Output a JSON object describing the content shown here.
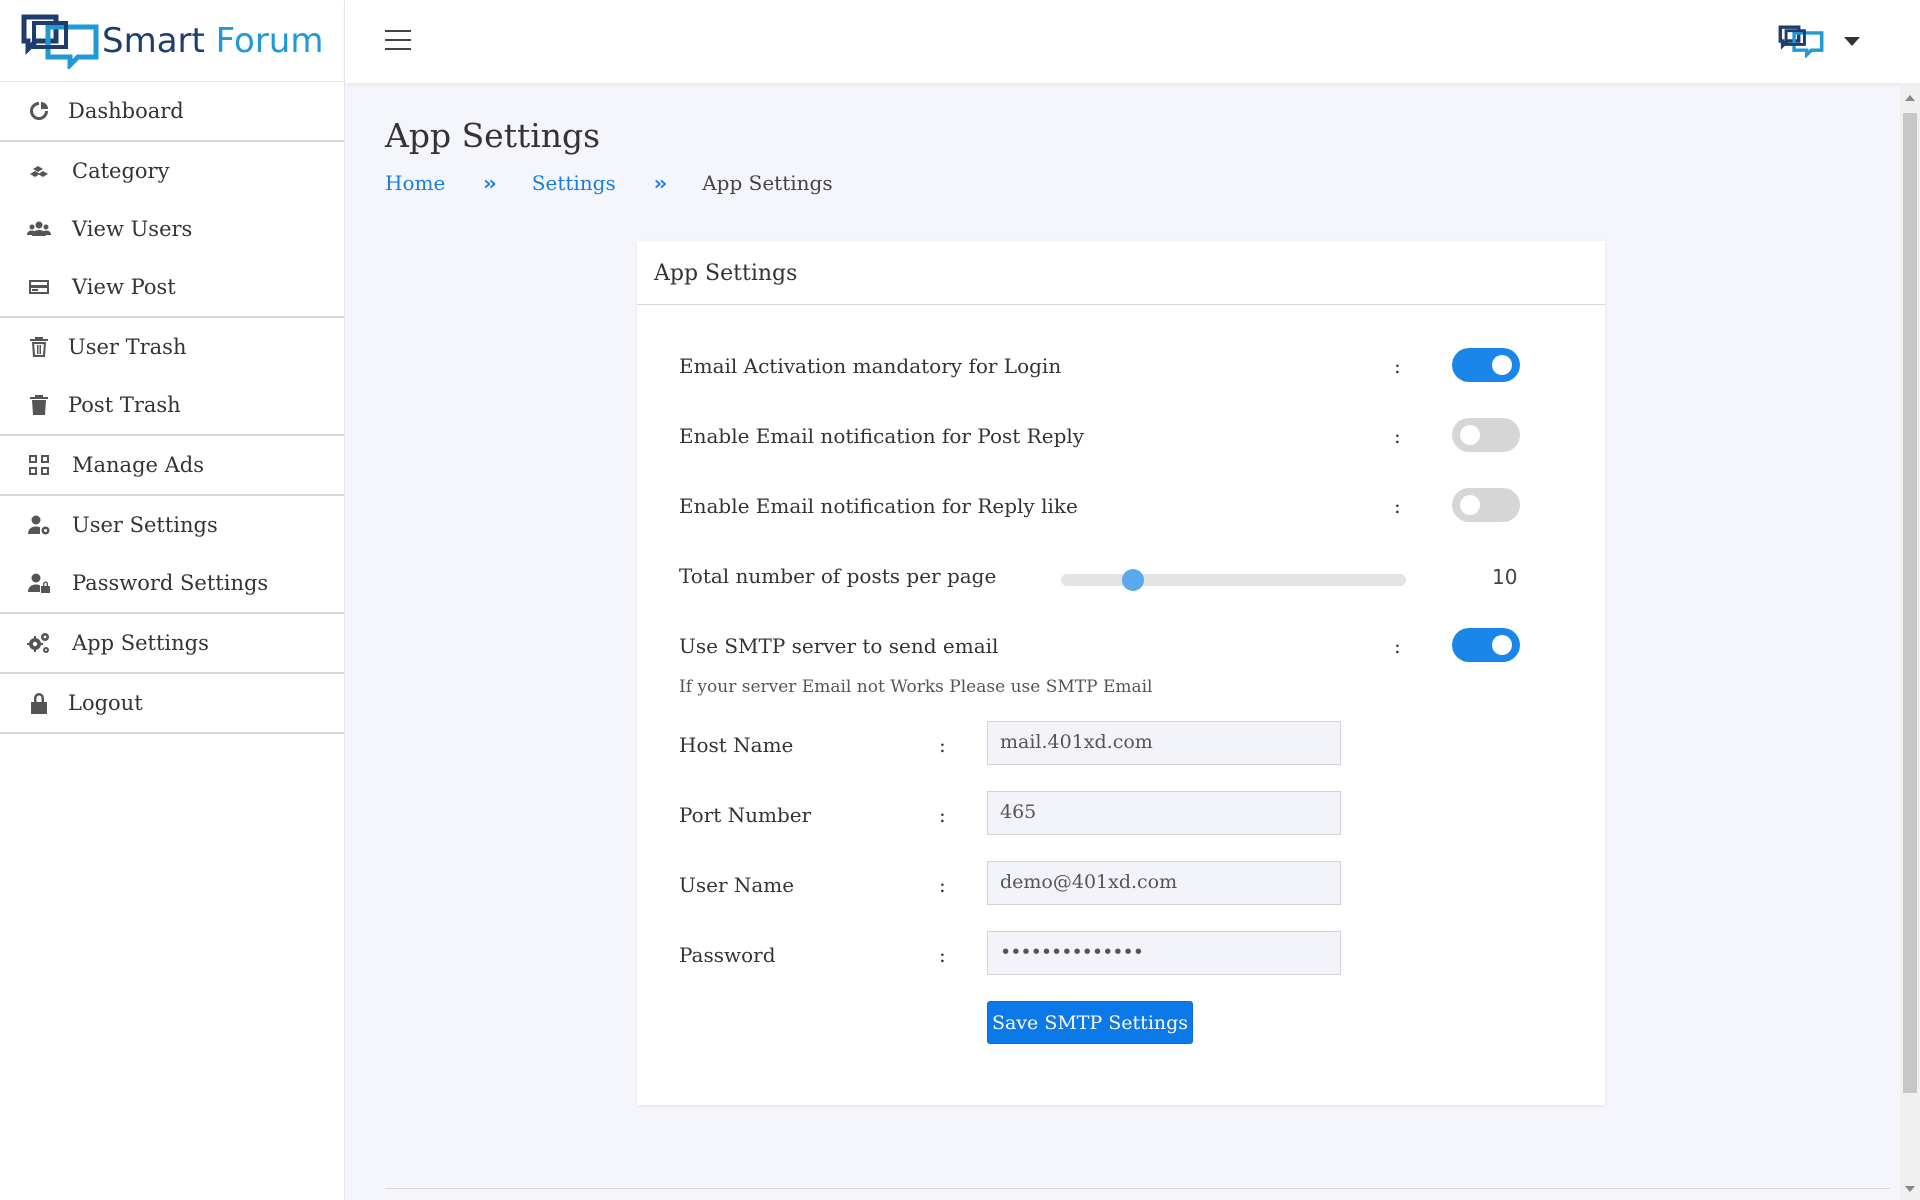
{
  "brand": {
    "name_part1": "Smart",
    "name_part2": "Forum"
  },
  "sidebar": {
    "groups": [
      [
        {
          "label": "Dashboard",
          "icon": "dashboard-icon"
        }
      ],
      [
        {
          "label": "Category",
          "icon": "category-icon"
        },
        {
          "label": "View Users",
          "icon": "users-icon"
        },
        {
          "label": "View Post",
          "icon": "post-icon"
        }
      ],
      [
        {
          "label": "User Trash",
          "icon": "trash-outline-icon"
        },
        {
          "label": "Post Trash",
          "icon": "trash-icon"
        }
      ],
      [
        {
          "label": "Manage Ads",
          "icon": "grid-icon"
        }
      ],
      [
        {
          "label": "User Settings",
          "icon": "user-cog-icon"
        },
        {
          "label": "Password Settings",
          "icon": "user-lock-icon"
        }
      ],
      [
        {
          "label": "App Settings",
          "icon": "cogs-icon"
        }
      ],
      [
        {
          "label": "Logout",
          "icon": "lock-icon"
        }
      ]
    ]
  },
  "page": {
    "title": "App Settings",
    "breadcrumb": {
      "home": "Home",
      "settings": "Settings",
      "current": "App Settings"
    }
  },
  "card": {
    "title": "App Settings",
    "toggles": [
      {
        "label": "Email Activation mandatory for Login",
        "on": true
      },
      {
        "label": "Enable Email notification for Post Reply",
        "on": false
      },
      {
        "label": "Enable Email notification for Reply like",
        "on": false
      }
    ],
    "posts_per_page": {
      "label": "Total number of posts per page",
      "value": "10",
      "fraction": 0.19
    },
    "smtp": {
      "label": "Use SMTP server to send email",
      "on": true,
      "hint": "If your server Email not Works Please use SMTP Email"
    },
    "fields": [
      {
        "label": "Host Name",
        "value": "mail.401xd.com"
      },
      {
        "label": "Port Number",
        "value": "465"
      },
      {
        "label": "User Name",
        "value": "demo@401xd.com"
      },
      {
        "label": "Password",
        "value": "••••••••••••••"
      }
    ],
    "colon": ":",
    "save_label": "Save SMTP Settings"
  },
  "colors": {
    "accent": "#1a86ea",
    "link": "#1a7ee0",
    "button": "#0b79e8"
  }
}
